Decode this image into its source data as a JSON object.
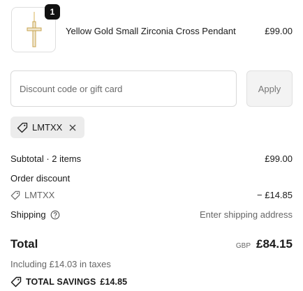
{
  "product": {
    "quantity": "1",
    "name": "Yellow Gold Small Zirconia Cross Pendant",
    "price": "£99.00",
    "image_icon": "cross-pendant-icon"
  },
  "discount": {
    "placeholder": "Discount code or gift card",
    "value": "",
    "apply_label": "Apply",
    "applied_code": "LMTXX"
  },
  "summary": {
    "subtotal_label": "Subtotal · 2 items",
    "subtotal_value": "£99.00",
    "order_discount_label": "Order discount",
    "discount_code": "LMTXX",
    "discount_value": "− £14.85",
    "shipping_label": "Shipping",
    "shipping_value": "Enter shipping address",
    "total_label": "Total",
    "currency": "GBP",
    "total_value": "£84.15",
    "taxes_note": "Including £14.03 in taxes",
    "savings_label": "TOTAL SAVINGS",
    "savings_value": "£14.85"
  },
  "colors": {
    "badge_bg": "#111111",
    "tag_bg": "#ececec",
    "muted_text": "#666666",
    "border": "#d9d9d9"
  }
}
